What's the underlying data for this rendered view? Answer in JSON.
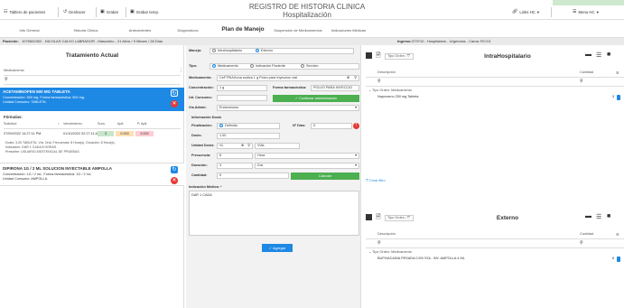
{
  "toolbar": {
    "patients_board": "Tablero de pacientes",
    "undo": "Deshacer",
    "save": "Grabar",
    "save_temp": "Grabar temp.",
    "link_hc": "Links HC",
    "menu_hc": "Menu HC"
  },
  "header": {
    "title_line1": "REGISTRO DE HISTORIA CLINICA",
    "title_line2": "Hospitalización"
  },
  "nav_tabs": [
    {
      "label": "Info General"
    },
    {
      "label": "Historia Clinica"
    },
    {
      "label": "Antecedentes"
    },
    {
      "label": "Diagnosticos"
    },
    {
      "label": "Plan de Manejo"
    },
    {
      "label": "Suspensión de Medicamentos"
    },
    {
      "label": "Indicaciones Médicas"
    }
  ],
  "patient_bar": {
    "patient_label": "Paciente:",
    "patient_value": "1075602302 - NICOLAS CALVO LABRADOR - Masculino - 21 Años / 9 Meses / 28 Días",
    "ingreso_label": "Ingreso:",
    "ingreso_value": "373710 - Hospitalario - Urgencias - Cama: RC/13"
  },
  "left": {
    "title": "Tratamiento Actual",
    "med_label": "Medicamento",
    "card1": {
      "name": "ACETAMINOFEN 500 MG TABLETA",
      "line1": "Concentración: 500 mg. Forma farmacéutica: 500 mg.",
      "line2": "Unidad Consumo: TABLETA."
    },
    "formulas": "Fórmulas:",
    "cols": {
      "solicitud": "Solicitud",
      "vencimiento": "Vencimiento",
      "sum": "Sum.",
      "apli": "Apli.",
      "papli": "P. Apli."
    },
    "row": {
      "solicitud": "27/09/2022 14:27:11 PM",
      "vencimiento": "01/10/2022 02:27:11 AM",
      "sum": "3",
      "apli": "0.000",
      "papli": "3.000"
    },
    "dosis": "Dosis: 3.00 TABLETA. Vía: Oral. Frecuencia: 8 Hora(s). Duración: 8 Hora(s).",
    "indicacion": "Indicación: DAR 1 CADA 8 HORAS",
    "prescribe": "Prescribe: USUARIO ASISTENCIAL DE PRUEBAS",
    "card2": {
      "name": "DIPIRONA 1G / 2 ML SOLUCION INYECTABLE AMPOLLA",
      "line1": "Concentración: 1G / 2 mL. Forma farmacéutica: 1G / 2 mL.",
      "line2": "Unidad Consumo: AMPOLLA."
    }
  },
  "middle": {
    "manejo_label": "Manejo:",
    "manejo_opt1": "Intrahospitalario",
    "manejo_opt2": "Externo",
    "tipo_label": "Tipo:",
    "tipo_opt1": "Medicamento",
    "tipo_opt2": "Indicación Paciente",
    "tipo_opt3": "Servicio",
    "medicamento_label": "Medicamento:",
    "medicamento_value": "CeFTRIAXona sodica 1 g Polvo para Inyeccion vial",
    "concentracion_label": "Concentración:",
    "concentracion_value": "1 g",
    "forma_label": "Forma farmacéutica:",
    "forma_value": "POLVO PARA INYECCIO",
    "udconsumo_label": "Ud. Consumo:",
    "via_label": "Vía Admin:",
    "via_value": "Endovenoso",
    "confirm_btn": "Confirmar administración",
    "info_dosis": "Información Dosis",
    "finalizacion_label": "Finalización:",
    "finalizacion_value": "Definido",
    "ndias_label": "Nº Días:",
    "ndias_value": "0",
    "dosis_label": "Dosis:",
    "dosis_value": "1.00",
    "unidad_label": "Unidad Dosis:",
    "unidad_value1": "VL",
    "unidad_value2": "VIAL",
    "frecuencia_label": "Frecuencia:",
    "frecuencia_value": "8",
    "frecuencia_unit": "Hora",
    "duracion_label": "Duración:",
    "duracion_value": "3",
    "duracion_unit": "Día",
    "cantidad_label": "Cantidad:",
    "cantidad_value": "9",
    "calcular_btn": "Calcular",
    "indicacion_label": "Indicación Médica: *",
    "indicacion_value": "DAR 1 CADA",
    "agregar_btn": "Agregar"
  },
  "right_top": {
    "title": "IntraHospitalario",
    "tipo_orden": "Tipo Orden",
    "descripcion": "Descripción",
    "cantidad": "Cantidad",
    "group": "Tipo Orden: Medicamento",
    "item": "Naproxeno 250 mg Tableta",
    "item_qty": "3",
    "crear_filtro": "Crear filtro"
  },
  "right_bottom": {
    "title": "Externo",
    "tipo_orden": "Tipo Orden",
    "descripcion": "Descripción",
    "cantidad": "Cantidad",
    "group": "Tipo Orden: Medicamento",
    "item": "BUPIVACAINA PESADA 0.5% SOL. INY. AMPOLLA 4 ML",
    "item_qty": "6"
  },
  "colors": {
    "accent": "#1e88e5",
    "green": "#4caf50",
    "red": "#e53935",
    "bg": "#cfe9cf"
  }
}
